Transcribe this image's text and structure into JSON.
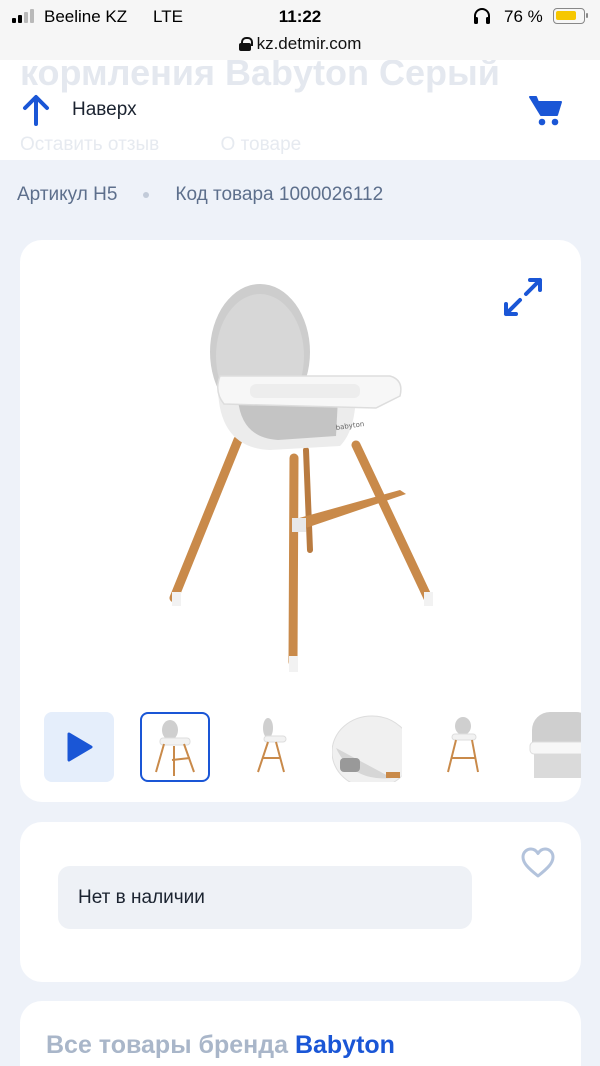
{
  "status_bar": {
    "carrier": "Beeline KZ",
    "network": "LTE",
    "time": "11:22",
    "battery": "76 %"
  },
  "browser": {
    "url": "kz.detmir.com"
  },
  "header": {
    "ghost_title": "кормления Babyton Серый",
    "ghost_links": [
      "Оставить отзыв",
      "О товаре"
    ],
    "back_to_top": "Наверх"
  },
  "product": {
    "article": "Артикул H5",
    "code": "Код товара 1000026112",
    "image_logo": "babyton",
    "thumbnails": [
      "video",
      "front",
      "side",
      "seat-closeup",
      "small-front",
      "tray-closeup"
    ],
    "selected_thumbnail": 1
  },
  "availability": {
    "status": "Нет в наличии"
  },
  "brand": {
    "prefix": "Все товары бренда",
    "name": "Babyton"
  },
  "colors": {
    "accent": "#1a56d6",
    "page_bg": "#eef2f9",
    "card_bg": "#ffffff"
  }
}
